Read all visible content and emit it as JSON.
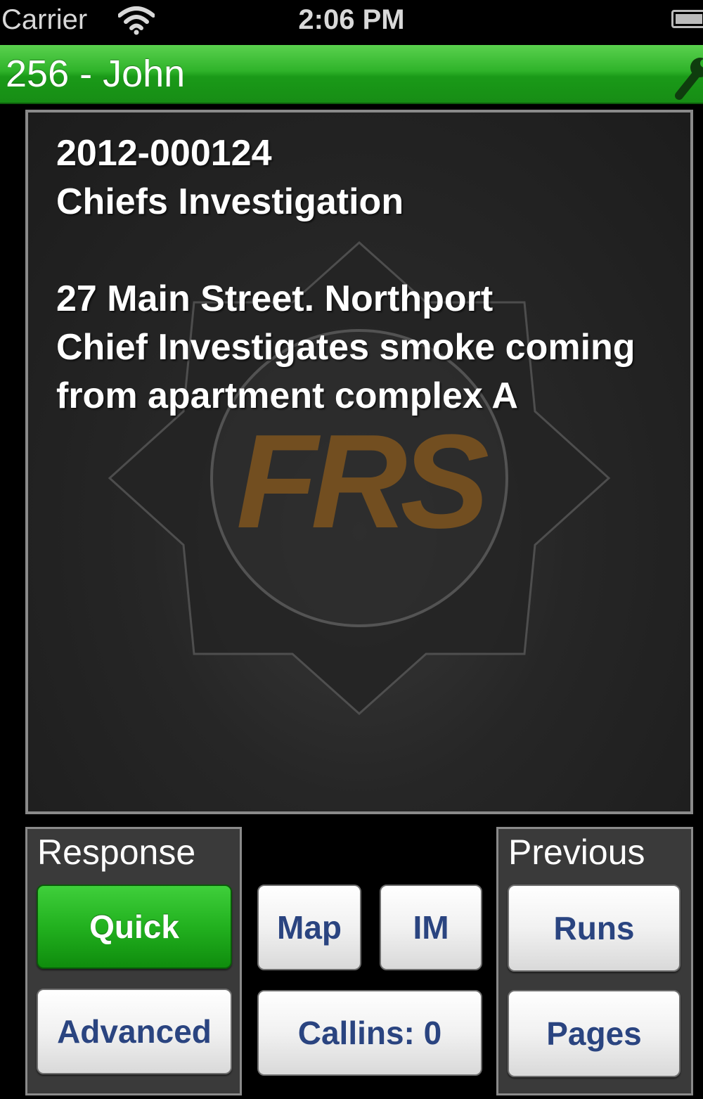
{
  "status_bar": {
    "carrier": "Carrier",
    "time": "2:06 PM"
  },
  "nav": {
    "title": "256 - John",
    "bar_color": "#2fb32a",
    "right_icon": "wrench-icon"
  },
  "incident": {
    "number": "2012-000124",
    "type": "Chiefs Investigation",
    "address": "27 Main Street. Northport",
    "description": "Chief Investigates smoke coming from apartment complex A",
    "logo_text": "FRS"
  },
  "response_group": {
    "title": "Response",
    "quick_label": "Quick",
    "advanced_label": "Advanced"
  },
  "center_buttons": {
    "map_label": "Map",
    "im_label": "IM",
    "callins_label": "Callins: 0"
  },
  "previous_group": {
    "title": "Previous",
    "runs_label": "Runs",
    "pages_label": "Pages"
  }
}
